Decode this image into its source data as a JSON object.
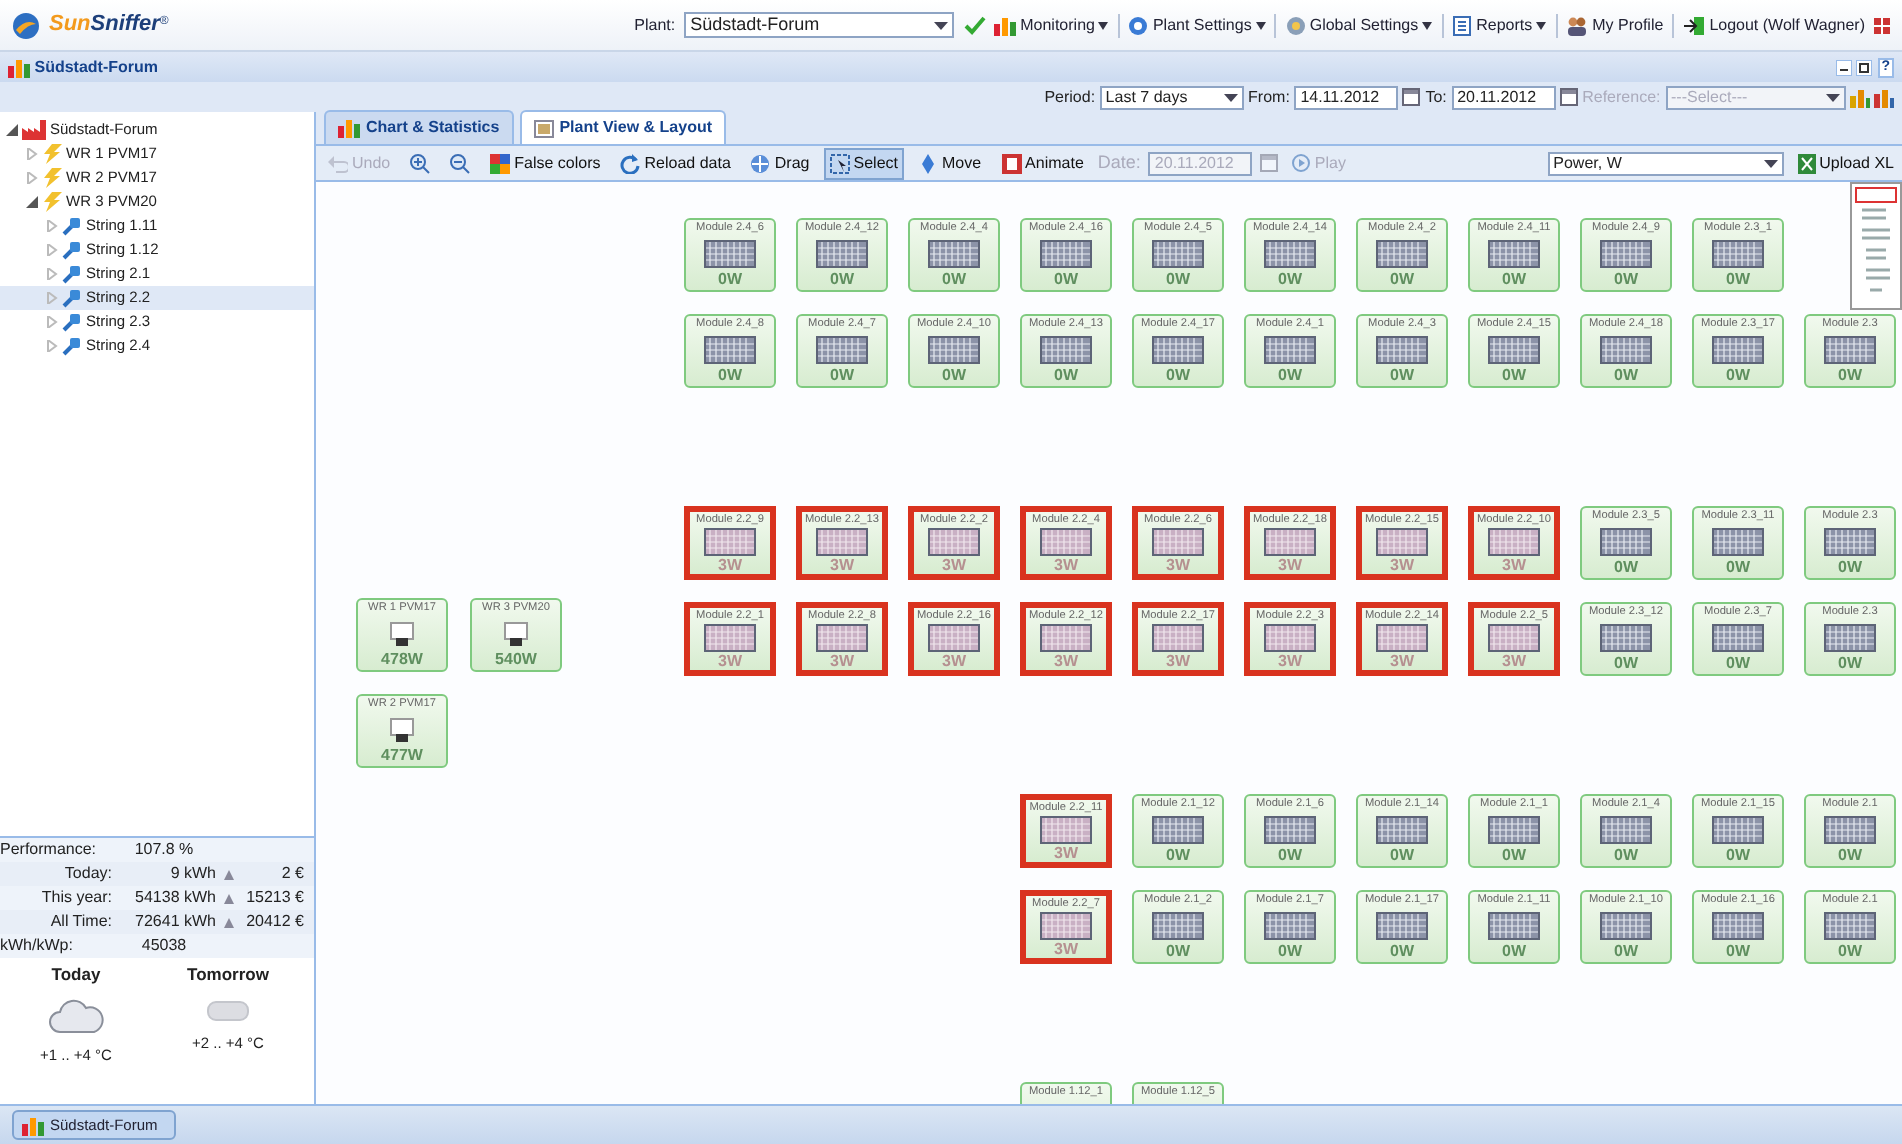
{
  "logo": {
    "text_1": "Sun",
    "text_2": "Sniffer",
    "mark": "®"
  },
  "header": {
    "plant_label": "Plant:",
    "plant_value": "Südstadt-Forum",
    "menu": [
      {
        "label": "Monitoring",
        "dropdown": true
      },
      {
        "label": "Plant Settings",
        "dropdown": true
      },
      {
        "label": "Global Settings",
        "dropdown": true
      },
      {
        "label": "Reports",
        "dropdown": true
      },
      {
        "label": "My Profile",
        "dropdown": false
      },
      {
        "label": "Logout (Wolf Wagner)",
        "dropdown": false
      }
    ]
  },
  "window": {
    "title": "Südstadt-Forum",
    "help_button": "?"
  },
  "filters": {
    "period_label": "Period:",
    "period_value": "Last 7 days",
    "from_label": "From:",
    "from_value": "14.11.2012",
    "to_label": "To:",
    "to_value": "20.11.2012",
    "reference_label": "Reference:",
    "reference_value": "---Select---",
    "reference_disabled": true
  },
  "tree": [
    {
      "label": "Südstadt-Forum",
      "expanded": true,
      "selected": false,
      "children": [
        {
          "label": "WR 1 PVM17",
          "expanded": false,
          "selected": false
        },
        {
          "label": "WR 2 PVM17",
          "expanded": false,
          "selected": false
        },
        {
          "label": "WR 3 PVM20",
          "expanded": true,
          "selected": false,
          "children": [
            {
              "label": "String 1.11",
              "expanded": false,
              "selected": false
            },
            {
              "label": "String 1.12",
              "expanded": false,
              "selected": false
            },
            {
              "label": "String 2.1",
              "expanded": false,
              "selected": false
            },
            {
              "label": "String 2.2",
              "expanded": false,
              "selected": true
            },
            {
              "label": "String 2.3",
              "expanded": false,
              "selected": false
            },
            {
              "label": "String 2.4",
              "expanded": false,
              "selected": false
            }
          ]
        }
      ]
    }
  ],
  "stats": [
    {
      "label": "Performance:",
      "value": "107.8 %"
    },
    {
      "label": "Today:",
      "value": "9 kWh",
      "money": "2 €"
    },
    {
      "label": "This year:",
      "value": "54138 kWh",
      "money": "15213 €"
    },
    {
      "label": "All Time:",
      "value": "72641 kWh",
      "money": "20412 €"
    },
    {
      "label": "kWh/kWp:",
      "value": "45038"
    }
  ],
  "weather": [
    {
      "day": "Today",
      "temp": "+1 .. +4 °C"
    },
    {
      "day": "Tomorrow",
      "temp": "+2 .. +4 °C"
    }
  ],
  "tabs": [
    {
      "label": "Chart & Statistics",
      "selected": false
    },
    {
      "label": "Plant View & Layout",
      "selected": true
    }
  ],
  "toolbar": {
    "buttons": [
      {
        "label": "Undo",
        "disabled": true,
        "selected": false
      },
      {
        "disabled": false,
        "selected": false
      },
      {
        "disabled": false,
        "selected": false
      },
      {
        "label": "False colors",
        "disabled": false,
        "selected": false
      },
      {
        "label": "Reload data",
        "disabled": false,
        "selected": false
      },
      {
        "label": "Drag",
        "disabled": false,
        "selected": false
      },
      {
        "label": "Select",
        "disabled": false,
        "selected": true
      },
      {
        "label": "Move",
        "disabled": false,
        "selected": false
      },
      {
        "label": "Animate",
        "disabled": false,
        "selected": false
      }
    ],
    "date_label": "Date:",
    "date_value": "20.11.2012",
    "date_disabled": true,
    "play_label": "Play",
    "play_disabled": true,
    "measure_value": "Power, W",
    "upload_label": "Upload XL"
  },
  "inverters": [
    {
      "name": "WR 1 PVM17",
      "power": "478W"
    },
    {
      "name": "WR 3 PVM20",
      "power": "540W"
    },
    {
      "name": "WR 2 PVM17",
      "power": "477W"
    }
  ],
  "module_rows": [
    [
      {
        "name": "Module 2.4_6",
        "power": "0W",
        "alert": false
      },
      {
        "name": "Module 2.4_12",
        "power": "0W",
        "alert": false
      },
      {
        "name": "Module 2.4_4",
        "power": "0W",
        "alert": false
      },
      {
        "name": "Module 2.4_16",
        "power": "0W",
        "alert": false
      },
      {
        "name": "Module 2.4_5",
        "power": "0W",
        "alert": false
      },
      {
        "name": "Module 2.4_14",
        "power": "0W",
        "alert": false
      },
      {
        "name": "Module 2.4_2",
        "power": "0W",
        "alert": false
      },
      {
        "name": "Module 2.4_11",
        "power": "0W",
        "alert": false
      },
      {
        "name": "Module 2.4_9",
        "power": "0W",
        "alert": false
      },
      {
        "name": "Module 2.3_1",
        "power": "0W",
        "alert": false
      }
    ],
    [
      {
        "name": "Module 2.4_8",
        "power": "0W",
        "alert": false
      },
      {
        "name": "Module 2.4_7",
        "power": "0W",
        "alert": false
      },
      {
        "name": "Module 2.4_10",
        "power": "0W",
        "alert": false
      },
      {
        "name": "Module 2.4_13",
        "power": "0W",
        "alert": false
      },
      {
        "name": "Module 2.4_17",
        "power": "0W",
        "alert": false
      },
      {
        "name": "Module 2.4_1",
        "power": "0W",
        "alert": false
      },
      {
        "name": "Module 2.4_3",
        "power": "0W",
        "alert": false
      },
      {
        "name": "Module 2.4_15",
        "power": "0W",
        "alert": false
      },
      {
        "name": "Module 2.4_18",
        "power": "0W",
        "alert": false
      },
      {
        "name": "Module 2.3_17",
        "power": "0W",
        "alert": false
      },
      {
        "name": "Module 2.3",
        "power": "0W",
        "alert": false
      }
    ],
    [
      {
        "name": "Module 2.2_9",
        "power": "3W",
        "alert": true
      },
      {
        "name": "Module 2.2_13",
        "power": "3W",
        "alert": true
      },
      {
        "name": "Module 2.2_2",
        "power": "3W",
        "alert": true
      },
      {
        "name": "Module 2.2_4",
        "power": "3W",
        "alert": true
      },
      {
        "name": "Module 2.2_6",
        "power": "3W",
        "alert": true
      },
      {
        "name": "Module 2.2_18",
        "power": "3W",
        "alert": true
      },
      {
        "name": "Module 2.2_15",
        "power": "3W",
        "alert": true
      },
      {
        "name": "Module 2.2_10",
        "power": "3W",
        "alert": true
      },
      {
        "name": "Module 2.3_5",
        "power": "0W",
        "alert": false
      },
      {
        "name": "Module 2.3_11",
        "power": "0W",
        "alert": false
      },
      {
        "name": "Module 2.3",
        "power": "0W",
        "alert": false
      }
    ],
    [
      {
        "name": "Module 2.2_1",
        "power": "3W",
        "alert": true
      },
      {
        "name": "Module 2.2_8",
        "power": "3W",
        "alert": true
      },
      {
        "name": "Module 2.2_16",
        "power": "3W",
        "alert": true
      },
      {
        "name": "Module 2.2_12",
        "power": "3W",
        "alert": true
      },
      {
        "name": "Module 2.2_17",
        "power": "3W",
        "alert": true
      },
      {
        "name": "Module 2.2_3",
        "power": "3W",
        "alert": true
      },
      {
        "name": "Module 2.2_14",
        "power": "3W",
        "alert": true
      },
      {
        "name": "Module 2.2_5",
        "power": "3W",
        "alert": true
      },
      {
        "name": "Module 2.3_12",
        "power": "0W",
        "alert": false
      },
      {
        "name": "Module 2.3_7",
        "power": "0W",
        "alert": false
      },
      {
        "name": "Module 2.3",
        "power": "0W",
        "alert": false
      }
    ],
    [
      {
        "name": "Module 2.2_11",
        "power": "3W",
        "alert": true
      },
      {
        "name": "Module 2.1_12",
        "power": "0W",
        "alert": false
      },
      {
        "name": "Module 2.1_6",
        "power": "0W",
        "alert": false
      },
      {
        "name": "Module 2.1_14",
        "power": "0W",
        "alert": false
      },
      {
        "name": "Module 2.1_1",
        "power": "0W",
        "alert": false
      },
      {
        "name": "Module 2.1_4",
        "power": "0W",
        "alert": false
      },
      {
        "name": "Module 2.1_15",
        "power": "0W",
        "alert": false
      },
      {
        "name": "Module 2.1",
        "power": "0W",
        "alert": false
      }
    ],
    [
      {
        "name": "Module 2.2_7",
        "power": "3W",
        "alert": true
      },
      {
        "name": "Module 2.1_2",
        "power": "0W",
        "alert": false
      },
      {
        "name": "Module 2.1_7",
        "power": "0W",
        "alert": false
      },
      {
        "name": "Module 2.1_17",
        "power": "0W",
        "alert": false
      },
      {
        "name": "Module 2.1_11",
        "power": "0W",
        "alert": false
      },
      {
        "name": "Module 2.1_10",
        "power": "0W",
        "alert": false
      },
      {
        "name": "Module 2.1_16",
        "power": "0W",
        "alert": false
      },
      {
        "name": "Module 2.1",
        "power": "0W",
        "alert": false
      }
    ],
    [
      {
        "name": "Module 1.12_1",
        "alert": false
      },
      {
        "name": "Module 1.12_5",
        "alert": false
      }
    ]
  ],
  "taskbar": [
    {
      "label": "Südstadt-Forum",
      "selected": true
    }
  ]
}
